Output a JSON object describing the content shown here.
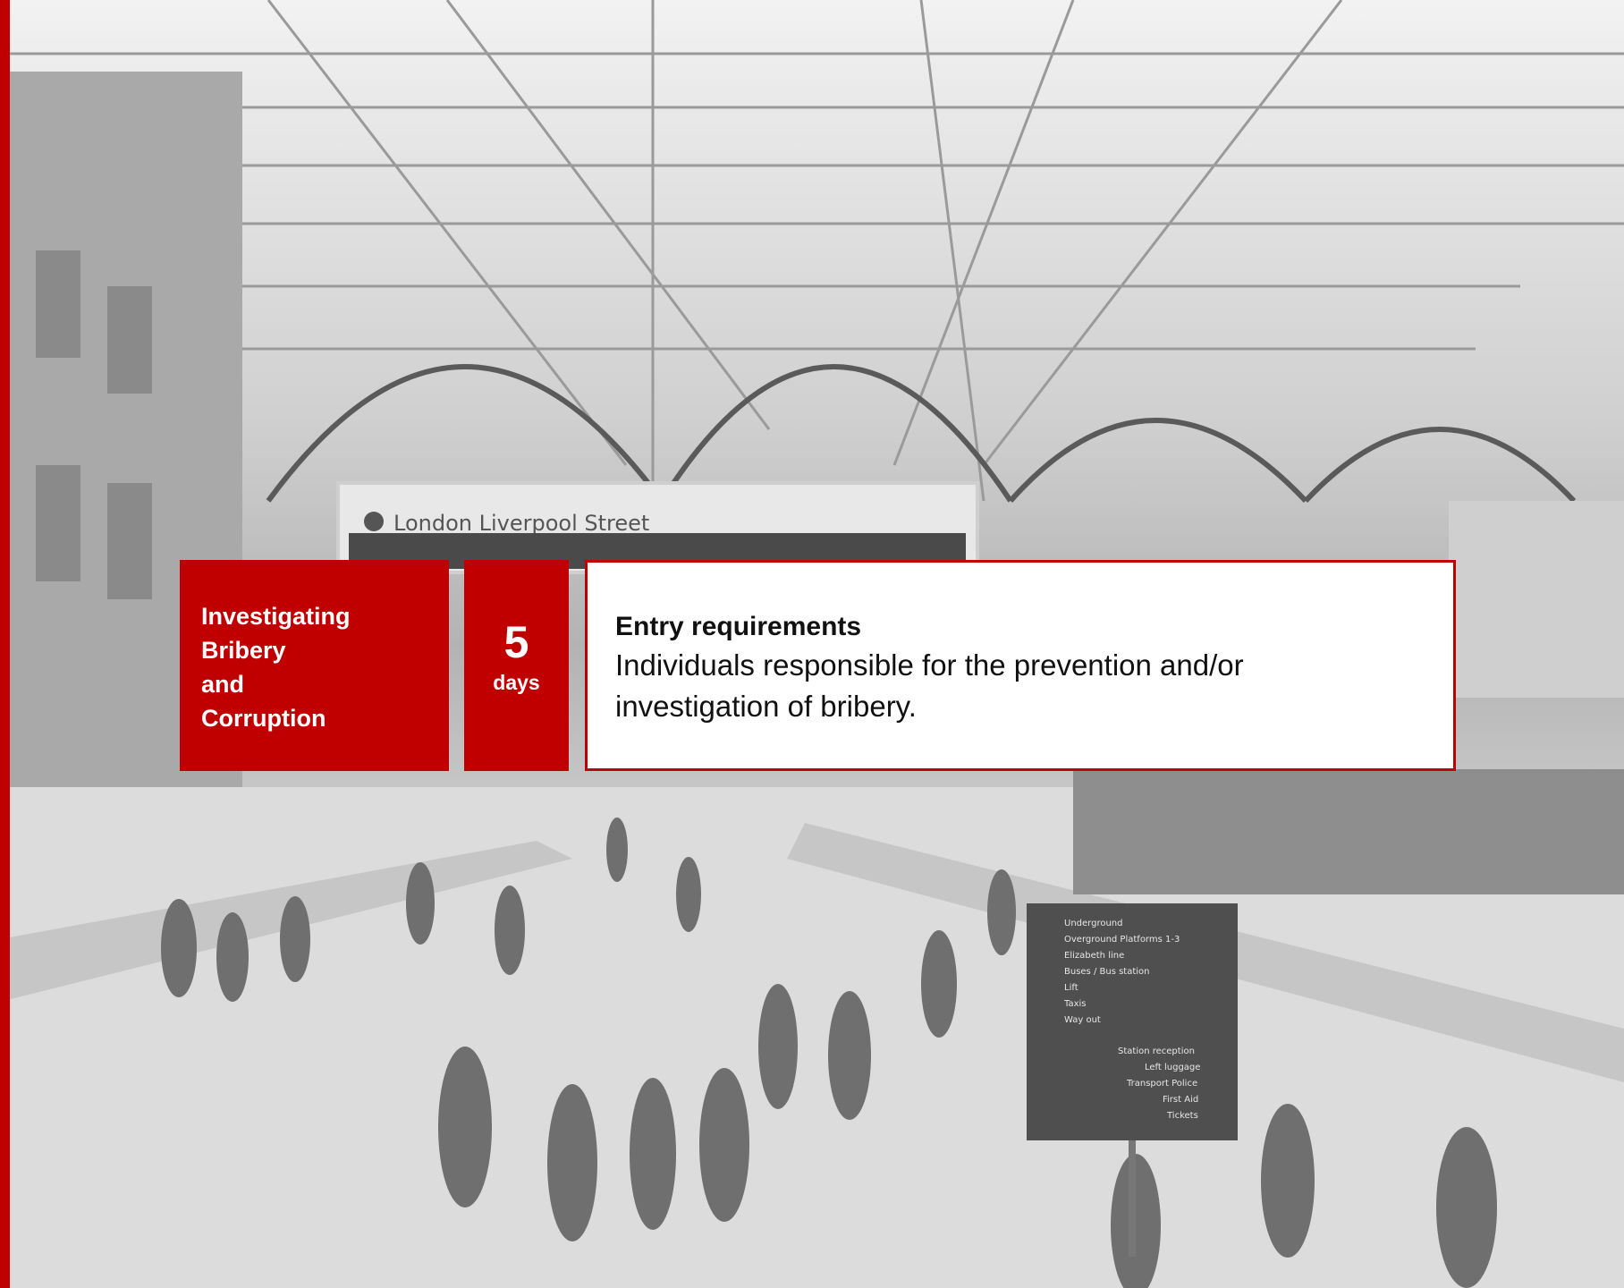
{
  "background": {
    "station_board_title": "London Liverpool Street",
    "wayfinding_sign_items": [
      "Underground",
      "Overground Platforms 1-3",
      "Elizabeth line",
      "Buses / Bus station",
      "Lift",
      "Taxis",
      "Way out",
      "Station reception",
      "Left luggage",
      "Transport Police",
      "First Aid",
      "Tickets"
    ]
  },
  "course": {
    "title_lines": [
      "Investigating",
      "Bribery",
      "and",
      "Corruption"
    ],
    "duration_value": "5",
    "duration_unit": "days"
  },
  "entry": {
    "heading": "Entry requirements",
    "text": "Individuals responsible for the prevention and/or investigation of bribery."
  },
  "colors": {
    "accent": "#c00000",
    "panel_bg": "#ffffff",
    "text": "#111111"
  }
}
